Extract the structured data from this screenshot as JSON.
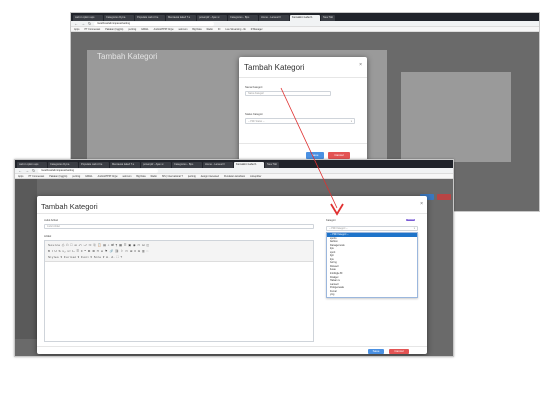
{
  "browser": {
    "tabs": [
      "web.it option aps",
      "Categories Dyna",
      "Populate web.it be",
      "Mentawai laked T.e",
      "powerpilr - Ajax si",
      "Categories - Bps",
      "Home - Laravel F",
      "Kemakimi Label 1",
      "New Tab"
    ],
    "tabs2": [
      "web.it option aps",
      "Categories Dyna",
      "Populate web.it be",
      "Mentawai laked T.e",
      "powerpilr - Ajax si",
      "Categories - Bps",
      "Home - Laravel F",
      "Kemakimi Label 1",
      "New Tab"
    ],
    "url": "localhost/adminpanel/setting",
    "bookmarks": [
      "Apps",
      "PT Connexaiet",
      "Pakaian (Inggris)",
      "pertinig",
      "GMAIL",
      "AndroidTPIP Orgw",
      "web.kon",
      "Big Data",
      "Radio",
      "IO",
      "Live Streaming - IE",
      "R Manager",
      "ISS | International T",
      "pertinig",
      "design interested",
      "Pendaran tamaSusi",
      "coiceprilier"
    ]
  },
  "modal_top": {
    "title": "Tambah Kategori",
    "nama_label": "Nama Kategori",
    "nama_placeholder": "Nama Kategori",
    "status_label": "Status Kategori",
    "status_value": "-- Pilih Status --",
    "save": "Save",
    "cancel": "Cancel"
  },
  "modal_bottom": {
    "title": "Tambah Kategori",
    "judul_label": "Judul Artikel",
    "judul_placeholder": "Judul Artikel",
    "artikel_label": "Artikel",
    "kategori_label": "Kategori",
    "kategori_value": "-- Pilih Kategori --",
    "badge": "Tambah",
    "toolbar_row1": "Source  ⎙ ▢ ☐ ⌫ ⤺ ⤻ ✂ ⎘ 📋 ▤ ⌕ ⇄ ¶ ▦ ☰ ▣ ◉ ▭ ⊟ ◫",
    "toolbar_row2": "B I U S x₂ x² Iₓ ☰ ≡ ❝ ⊏ ⊐ ⊓ ⊔ ⚑ 🔗 ⛓ ⚐ ▭ ⊞ ≡ Ω ▥ ◌",
    "format_row": "Styles  ▾  Format  ▾  Font  ▾  Size  ▾  A·  A·  ⛶  ?",
    "save": "Save",
    "cancel": "Cancel",
    "options": [
      "-- Pilih Kategori --",
      "sports",
      "fashion",
      "Danagemosis",
      "tipu",
      "sport",
      "ligit",
      "tipu",
      "boring",
      "Rowsell",
      "fusau",
      "Inlolingle Bl",
      "Drakgel",
      "Halsar ra",
      "Laravell",
      "Pologenwala",
      "Fumal",
      "ying"
    ]
  },
  "colors": {
    "accent": "#4a90e2",
    "cancel": "#e35353",
    "badge": "#7a5cd6",
    "arrow": "#e03030"
  }
}
